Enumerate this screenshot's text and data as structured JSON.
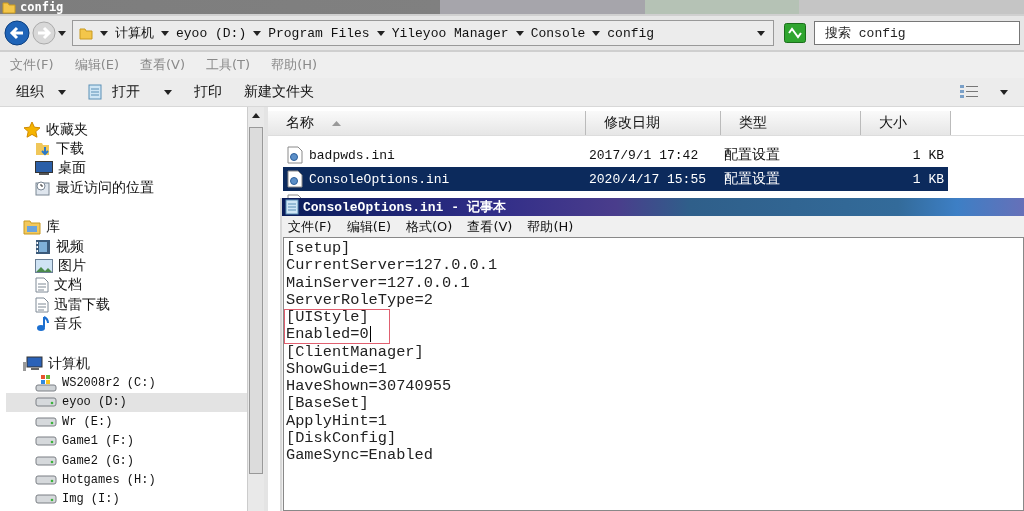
{
  "window": {
    "title": "config"
  },
  "address": {
    "breadcrumbs": [
      "计算机",
      "eyoo (D:)",
      "Program Files",
      "Yileyoo Manager",
      "Console",
      "config"
    ]
  },
  "search": {
    "placeholder": "搜索 config"
  },
  "menu": [
    "文件(F)",
    "编辑(E)",
    "查看(V)",
    "工具(T)",
    "帮助(H)"
  ],
  "toolbar": [
    {
      "label": "组织",
      "kind": "menu"
    },
    {
      "label": "打开",
      "kind": "open"
    },
    {
      "label": "打印",
      "kind": "plain"
    },
    {
      "label": "新建文件夹",
      "kind": "plain"
    }
  ],
  "sidebar": {
    "groups": [
      {
        "label": "收藏夹",
        "kind": "favorites",
        "children": [
          {
            "label": "下载",
            "kind": "download",
            "selected": false
          },
          {
            "label": "桌面",
            "kind": "desktop",
            "selected": false
          },
          {
            "label": "最近访问的位置",
            "kind": "recent",
            "selected": false
          }
        ]
      },
      {
        "label": "库",
        "kind": "library",
        "children": [
          {
            "label": "视频",
            "kind": "video",
            "selected": false
          },
          {
            "label": "图片",
            "kind": "picture",
            "selected": false
          },
          {
            "label": "文档",
            "kind": "document",
            "selected": false
          },
          {
            "label": "迅雷下载",
            "kind": "document",
            "selected": false
          },
          {
            "label": "音乐",
            "kind": "music",
            "selected": false
          }
        ]
      },
      {
        "label": "计算机",
        "kind": "computer",
        "children": [
          {
            "label": "WS2008r2 (C:)",
            "kind": "system",
            "selected": false
          },
          {
            "label": "eyoo (D:)",
            "kind": "drive",
            "selected": true
          },
          {
            "label": "Wr (E:)",
            "kind": "drive",
            "selected": false
          },
          {
            "label": "Game1 (F:)",
            "kind": "drive",
            "selected": false
          },
          {
            "label": "Game2 (G:)",
            "kind": "drive",
            "selected": false
          },
          {
            "label": "Hotgames (H:)",
            "kind": "drive",
            "selected": false
          },
          {
            "label": "Img (I:)",
            "kind": "drive",
            "selected": false
          }
        ]
      }
    ]
  },
  "table": {
    "columns": [
      {
        "label": "名称",
        "sorted": true
      },
      {
        "label": "修改日期",
        "sorted": false
      },
      {
        "label": "类型",
        "sorted": false
      },
      {
        "label": "大小",
        "sorted": false
      }
    ],
    "rows": [
      {
        "name": "badpwds.ini",
        "date": "2017/9/1 17:42",
        "type": "配置设置",
        "size": "1 KB",
        "selected": false
      },
      {
        "name": "ConsoleOptions.ini",
        "date": "2020/4/17 15:55",
        "type": "配置设置",
        "size": "1 KB",
        "selected": true
      }
    ]
  },
  "notepad": {
    "title": "ConsoleOptions.ini - 记事本",
    "menu": [
      "文件(F)",
      "编辑(E)",
      "格式(O)",
      "查看(V)",
      "帮助(H)"
    ],
    "lines": [
      {
        "text": "[setup]",
        "highlighted": false,
        "caret": false
      },
      {
        "text": "CurrentServer=127.0.0.1",
        "highlighted": false,
        "caret": false
      },
      {
        "text": "MainServer=127.0.0.1",
        "highlighted": false,
        "caret": false
      },
      {
        "text": "ServerRoleType=2",
        "highlighted": false,
        "caret": false
      },
      {
        "text": "[UIStyle]",
        "highlighted": true,
        "caret": false
      },
      {
        "text": "Enabled=0",
        "highlighted": true,
        "caret": true
      },
      {
        "text": "[ClientManager]",
        "highlighted": false,
        "caret": false
      },
      {
        "text": "ShowGuide=1",
        "highlighted": false,
        "caret": false
      },
      {
        "text": "HaveShown=30740955",
        "highlighted": false,
        "caret": false
      },
      {
        "text": "[BaseSet]",
        "highlighted": false,
        "caret": false
      },
      {
        "text": "ApplyHint=1",
        "highlighted": false,
        "caret": false
      },
      {
        "text": "[DiskConfig]",
        "highlighted": false,
        "caret": false
      },
      {
        "text": "GameSync=Enabled",
        "highlighted": false,
        "caret": false
      }
    ]
  }
}
